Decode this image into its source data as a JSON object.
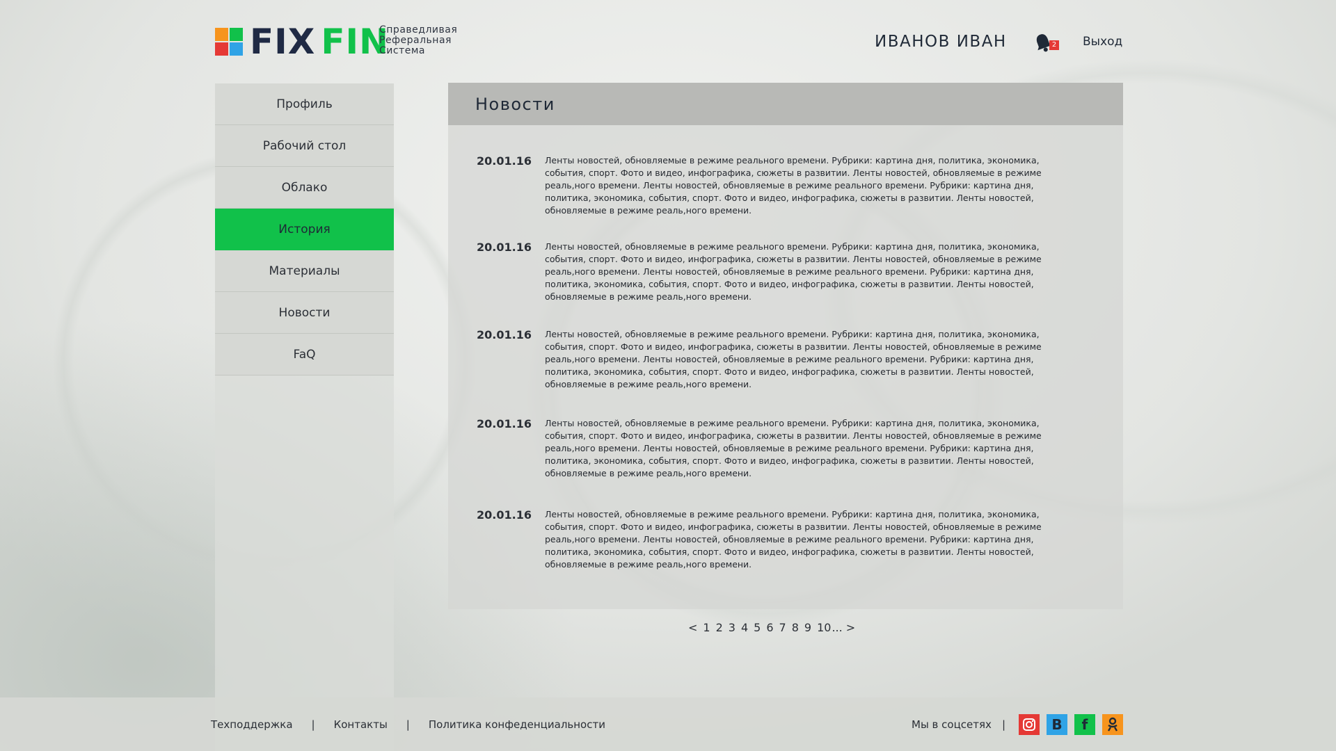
{
  "brand": {
    "fix": "FIX",
    "fin": "FIN",
    "tagline": [
      "Справедливая",
      "Реферальная",
      "Система"
    ],
    "colors": {
      "orange": "#f7941d",
      "green": "#11c14a",
      "blue": "#2fa3e6",
      "red": "#e53935",
      "dark": "#1f2a44"
    }
  },
  "header": {
    "username": "ИВАНОВ ИВАН",
    "notifications_count": "2",
    "logout_label": "Выход"
  },
  "sidebar": {
    "items": [
      {
        "label": "Профиль",
        "active": false
      },
      {
        "label": "Рабочий стол",
        "active": false
      },
      {
        "label": "Облако",
        "active": false
      },
      {
        "label": "История",
        "active": true
      },
      {
        "label": "Материалы",
        "active": false
      },
      {
        "label": "Новости",
        "active": false
      },
      {
        "label": "FaQ",
        "active": false
      }
    ]
  },
  "main": {
    "title": "Новости",
    "news": [
      {
        "date": "20.01.16",
        "text": "Ленты новостей, обновляемые в режиме реального времени. Рубрики: картина дня, политика, экономика, события, спорт. Фото и видео, инфографика, сюжеты в развитии. Ленты новостей, обновляемые в режиме реаль,ного времени.  Ленты новостей, обновляемые в режиме реального времени. Рубрики: картина дня, политика, экономика, события, спорт. Фото и видео, инфографика, сюжеты в развитии. Ленты новостей, обновляемые в режиме реаль,ного времени."
      },
      {
        "date": "20.01.16",
        "text": "Ленты новостей, обновляемые в режиме реального времени. Рубрики: картина дня, политика, экономика, события, спорт. Фото и видео, инфографика, сюжеты в развитии. Ленты новостей, обновляемые в режиме реаль,ного времени.  Ленты новостей, обновляемые в режиме реального времени. Рубрики: картина дня, политика, экономика, события, спорт. Фото и видео, инфографика, сюжеты в развитии. Ленты новостей, обновляемые в режиме реаль,ного времени."
      },
      {
        "date": "20.01.16",
        "text": "Ленты новостей, обновляемые в режиме реального времени. Рубрики: картина дня, политика, экономика, события, спорт. Фото и видео, инфографика, сюжеты в развитии. Ленты новостей, обновляемые в режиме реаль,ного времени.  Ленты новостей, обновляемые в режиме реального времени. Рубрики: картина дня, политика, экономика, события, спорт. Фото и видео, инфографика, сюжеты в развитии. Ленты новостей, обновляемые в режиме реаль,ного времени."
      },
      {
        "date": "20.01.16",
        "text": "Ленты новостей, обновляемые в режиме реального времени. Рубрики: картина дня, политика, экономика, события, спорт. Фото и видео, инфографика, сюжеты в развитии. Ленты новостей, обновляемые в режиме реаль,ного времени.  Ленты новостей, обновляемые в режиме реального времени. Рубрики: картина дня, политика, экономика, события, спорт. Фото и видео, инфографика, сюжеты в развитии. Ленты новостей, обновляемые в режиме реаль,ного времени."
      },
      {
        "date": "20.01.16",
        "text": "Ленты новостей, обновляемые в режиме реального времени. Рубрики: картина дня, политика, экономика, события, спорт. Фото и видео, инфографика, сюжеты в развитии. Ленты новостей, обновляемые в режиме реаль,ного времени.  Ленты новостей, обновляемые в режиме реального времени. Рубрики: картина дня, политика, экономика, события, спорт. Фото и видео, инфографика, сюжеты в развитии. Ленты новостей, обновляемые в режиме реаль,ного времени."
      }
    ]
  },
  "pagination": {
    "prev": "<",
    "pages": [
      "1",
      "2",
      "3",
      "4",
      "5",
      "6",
      "7",
      "8",
      "9",
      "10"
    ],
    "ellipsis": "...",
    "next": ">"
  },
  "footer": {
    "links": [
      "Техподдержка",
      "Контакты",
      "Политика конфеденциальности"
    ],
    "separator": "|",
    "social_label": "Мы в соцсетях",
    "social": [
      {
        "name": "instagram-icon",
        "color": "#e53935"
      },
      {
        "name": "vk-icon",
        "glyph": "B",
        "color": "#2fa3e6"
      },
      {
        "name": "facebook-icon",
        "glyph": "f",
        "color": "#11c14a"
      },
      {
        "name": "odnoklassniki-icon",
        "color": "#f7941d"
      }
    ]
  }
}
